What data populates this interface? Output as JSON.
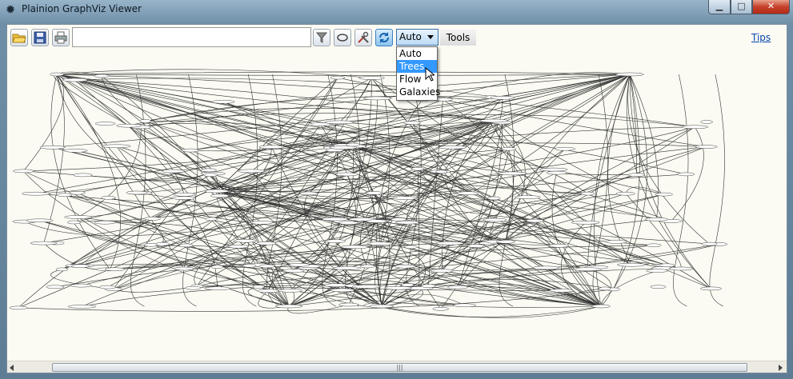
{
  "window": {
    "title": "Plainion GraphViz Viewer",
    "app_icon": "plainion-gear-icon"
  },
  "caption": {
    "minimize_icon": "minimize-icon",
    "maximize_icon": "maximize-icon",
    "close_icon": "close-icon"
  },
  "toolbar": {
    "open_icon": "folder-open-icon",
    "save_icon": "save-icon",
    "print_icon": "print-icon",
    "search_value": "",
    "filter_icon": "filter-icon",
    "ellipse_icon": "ellipse-icon",
    "settings_icon": "tools-icon",
    "refresh_icon": "refresh-icon",
    "layout_selected": "Auto",
    "tools_label": "Tools",
    "tips_label": "Tips"
  },
  "layout_dropdown": {
    "options": [
      "Auto",
      "Trees",
      "Flow",
      "Galaxies"
    ],
    "highlighted": "Trees"
  },
  "scrollbar": {
    "grip": "|||"
  },
  "colors": {
    "highlight": "#3399ff",
    "canvas": "#fbfbf3",
    "link": "#0645ad"
  }
}
